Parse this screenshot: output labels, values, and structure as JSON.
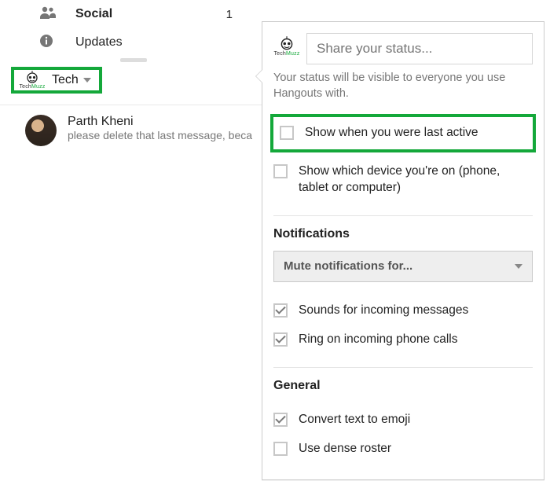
{
  "brand": {
    "name_a": "Tech",
    "name_b": "Muzz"
  },
  "sidebar": {
    "items": [
      {
        "label": "Social",
        "count": "1"
      },
      {
        "label": "Updates"
      }
    ],
    "account": {
      "label": "Tech"
    }
  },
  "conversation": {
    "name": "Parth Kheni",
    "preview": "please delete that last message, beca"
  },
  "popover": {
    "status_placeholder": "Share your status...",
    "status_hint": "Your status will be visible to everyone you use Hangouts with.",
    "opts_top": [
      {
        "label": "Show when you were last active",
        "checked": false,
        "highlight": true
      },
      {
        "label": "Show which device you're on (phone, tablet or computer)",
        "checked": false
      }
    ],
    "notifications": {
      "title": "Notifications",
      "mute_label": "Mute notifications for...",
      "opts": [
        {
          "label": "Sounds for incoming messages",
          "checked": true
        },
        {
          "label": "Ring on incoming phone calls",
          "checked": true
        }
      ]
    },
    "general": {
      "title": "General",
      "opts": [
        {
          "label": "Convert text to emoji",
          "checked": true
        },
        {
          "label": "Use dense roster",
          "checked": false
        }
      ]
    }
  }
}
